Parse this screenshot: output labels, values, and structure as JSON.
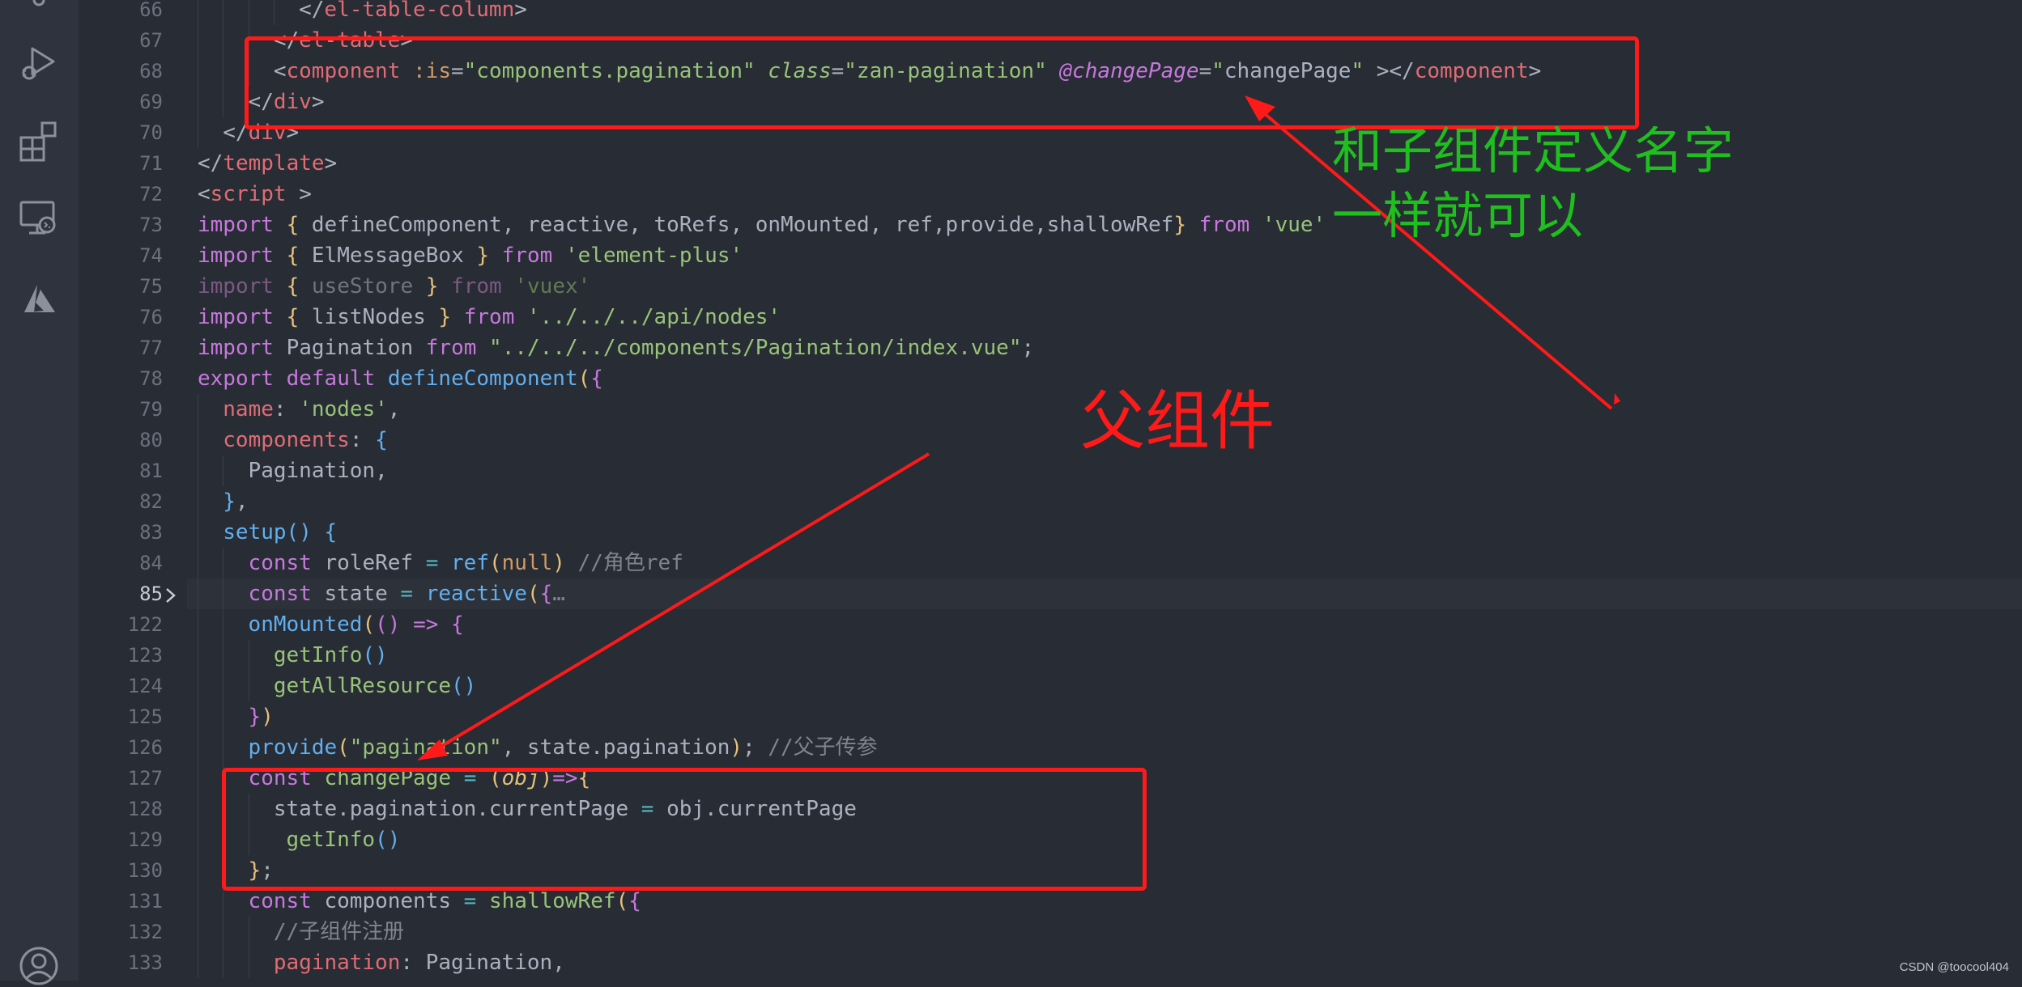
{
  "editor": {
    "active_line": "85",
    "lines": [
      {
        "no": "66",
        "code": "</el-table-column>"
      },
      {
        "no": "67",
        "code": "</el-table>"
      },
      {
        "no": "68",
        "code": "<component :is=\"components.pagination\" class=\"zan-pagination\" @changePage=\"changePage\" ></component>"
      },
      {
        "no": "69",
        "code": "</div>"
      },
      {
        "no": "70",
        "code": "</div>"
      },
      {
        "no": "71",
        "code": "</template>"
      },
      {
        "no": "72",
        "code": "<script >"
      },
      {
        "no": "73",
        "code": "import { defineComponent, reactive, toRefs, onMounted, ref,provide,shallowRef} from 'vue'"
      },
      {
        "no": "74",
        "code": "import { ElMessageBox } from 'element-plus'"
      },
      {
        "no": "75",
        "code": "import { useStore } from 'vuex'"
      },
      {
        "no": "76",
        "code": "import { listNodes } from '../../../api/nodes'"
      },
      {
        "no": "77",
        "code": "import Pagination from \"../../../components/Pagination/index.vue\";"
      },
      {
        "no": "78",
        "code": "export default defineComponent({"
      },
      {
        "no": "79",
        "code": "name: 'nodes',"
      },
      {
        "no": "80",
        "code": "components: {"
      },
      {
        "no": "81",
        "code": "Pagination,"
      },
      {
        "no": "82",
        "code": "},"
      },
      {
        "no": "83",
        "code": "setup() {"
      },
      {
        "no": "84",
        "code": "const roleRef = ref(null) //角色ref"
      },
      {
        "no": "85",
        "code": "const state = reactive({…"
      },
      {
        "no": "122",
        "code": "onMounted(() => {"
      },
      {
        "no": "123",
        "code": "getInfo()"
      },
      {
        "no": "124",
        "code": "getAllResource()"
      },
      {
        "no": "125",
        "code": "})"
      },
      {
        "no": "126",
        "code": "provide(\"pagination\", state.pagination); //父子传参"
      },
      {
        "no": "127",
        "code": "const changePage = (obj)=>{"
      },
      {
        "no": "128",
        "code": "state.pagination.currentPage = obj.currentPage"
      },
      {
        "no": "129",
        "code": "getInfo()"
      },
      {
        "no": "130",
        "code": "};"
      },
      {
        "no": "131",
        "code": "const components = shallowRef({"
      },
      {
        "no": "132",
        "code": "//子组件注册"
      },
      {
        "no": "133",
        "code": "pagination: Pagination,"
      }
    ],
    "tokens": {
      "l66": [
        "</",
        "el-table-column",
        ">"
      ],
      "l67": [
        "</",
        "el-table",
        ">"
      ],
      "l68": [
        "<",
        "component",
        " ",
        ":is",
        "=",
        "\"components.pagination\"",
        " ",
        "class",
        "=",
        "\"zan-pagination\"",
        " ",
        "@changePage",
        "=",
        "\"",
        "changePage",
        "\"",
        " ></",
        "component",
        ">"
      ],
      "l69": [
        "</",
        "div",
        ">"
      ],
      "l70": [
        "</",
        "div",
        ">"
      ],
      "l71": [
        "</",
        "template",
        ">"
      ],
      "l72": [
        "<",
        "script",
        " >"
      ],
      "l73": [
        "import",
        " ",
        "{",
        " defineComponent, reactive, toRefs, onMounted, ref,provide,shallowRef",
        "}",
        " ",
        "from",
        " ",
        "'vue'"
      ],
      "l74": [
        "import",
        " ",
        "{",
        " ElMessageBox ",
        "}",
        " ",
        "from",
        " ",
        "'element-plus'"
      ],
      "l75": [
        "import",
        " ",
        "{",
        " useStore ",
        "}",
        " ",
        "from",
        " ",
        "'vuex'"
      ],
      "l76": [
        "import",
        " ",
        "{",
        " listNodes ",
        "}",
        " ",
        "from",
        " ",
        "'../../../api/nodes'"
      ],
      "l77": [
        "import",
        " Pagination ",
        "from",
        " ",
        "\"../../../components/Pagination/index.vue\"",
        ";"
      ],
      "l78": [
        "export",
        " ",
        "default",
        " ",
        "defineComponent",
        "(",
        "{"
      ],
      "l79": [
        "name",
        ": ",
        "'nodes'",
        ","
      ],
      "l80": [
        "components",
        ": ",
        "{"
      ],
      "l81": [
        "Pagination,"
      ],
      "l82": [
        "}",
        ","
      ],
      "l83": [
        "setup",
        "()",
        " ",
        "{"
      ],
      "l84": [
        "const",
        " roleRef ",
        "=",
        " ",
        "ref",
        "(",
        "null",
        ")",
        " //角色ref"
      ],
      "l85": [
        "const",
        " state ",
        "=",
        " ",
        "reactive",
        "(",
        "{",
        "…"
      ],
      "l122": [
        "onMounted",
        "(",
        "()",
        " ",
        "=>",
        " ",
        "{"
      ],
      "l123": [
        "getInfo",
        "()"
      ],
      "l124": [
        "getAllResource",
        "()"
      ],
      "l125": [
        "}",
        ")"
      ],
      "l126": [
        "provide",
        "(",
        "\"pagination\"",
        ", state.pagination",
        ")",
        "; ",
        "//父子传参"
      ],
      "l127": [
        "const",
        " ",
        "changePage",
        " ",
        "=",
        " ",
        "(",
        "obj",
        ")",
        "=>",
        "{"
      ],
      "l128": [
        "state.pagination.currentPage ",
        "=",
        " obj.currentPage"
      ],
      "l129": [
        "getInfo",
        "()"
      ],
      "l130": [
        "}",
        ";"
      ],
      "l131": [
        "const",
        " components ",
        "=",
        " ",
        "shallowRef",
        "(",
        "{"
      ],
      "l132": [
        "//子组件注册"
      ],
      "l133": [
        "pagination",
        ": Pagination,"
      ]
    }
  },
  "annotations": {
    "note_right": [
      "和子组件定义名字",
      "一样就可以"
    ],
    "note_parent": "父组件",
    "colors": {
      "red": "#ff1a1a",
      "green": "#1fbf1f"
    }
  },
  "activity_bar": {
    "icons": [
      "run-debug-icon",
      "extensions-icon",
      "remote-explorer-icon",
      "azure-icon",
      "account-icon"
    ]
  },
  "watermark": "CSDN @toocool404",
  "theme": {
    "background": "#282c34",
    "activity_bar": "#2f333d"
  }
}
